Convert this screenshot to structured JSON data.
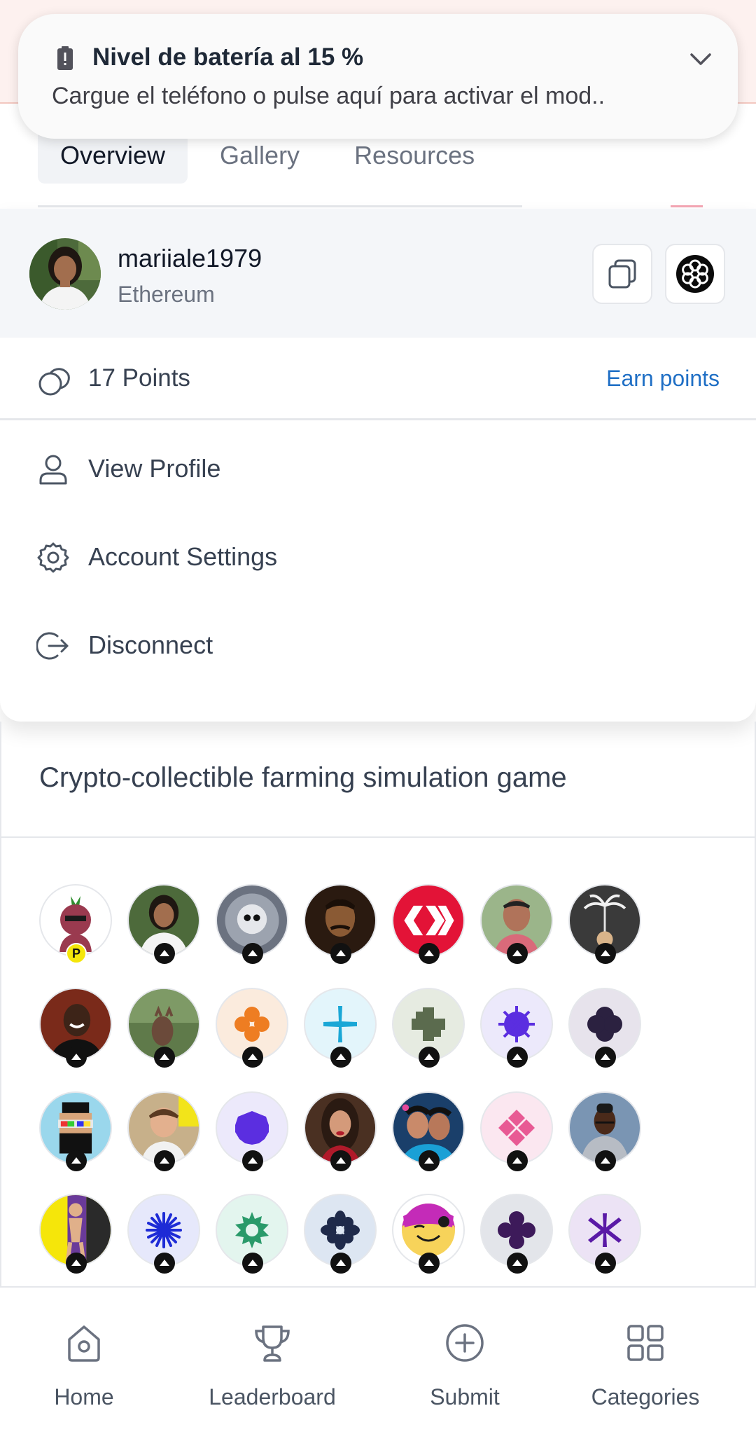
{
  "notification": {
    "title": "Nivel de batería al 15 %",
    "body": "Cargue el teléfono o pulse aquí para activar el mod.."
  },
  "tabs": [
    {
      "label": "Overview"
    },
    {
      "label": "Gallery"
    },
    {
      "label": "Resources"
    }
  ],
  "account": {
    "username": "mariiale1979",
    "network": "Ethereum",
    "points": "17 Points",
    "earn_link": "Earn points"
  },
  "menu": {
    "view_profile": "View Profile",
    "account_settings": "Account Settings",
    "disconnect": "Disconnect"
  },
  "description": "Crypto-collectible farming simulation game",
  "voter_badge_letter": "P",
  "bottom_nav": {
    "home": "Home",
    "leaderboard": "Leaderboard",
    "submit": "Submit",
    "categories": "Categories"
  },
  "colors": {
    "accent_link": "#1f6fc5",
    "badge_yellow": "#f5e60a"
  }
}
